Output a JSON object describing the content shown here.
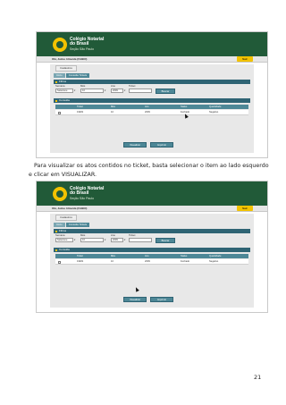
{
  "screenshots": [
    {
      "logo": {
        "line1": "Colégio Notarial",
        "line2": "do Brasil",
        "line3": "Seção São Paulo"
      },
      "user_text": "Olá, Jaime Almeida (FABIO)",
      "logout_label": "Sair",
      "menu_tab": "Cadastros",
      "breadcrumbs": [
        "Início",
        "Consulta Tickets"
      ],
      "filter_panel_title": "Filtros",
      "filters": {
        "semana_label": "Semana",
        "semana_value": "Selecione",
        "mes_label": "Mês",
        "mes_value": "10",
        "ano_label": "Ano",
        "ano_value": "2009",
        "ticket_label": "Ticket",
        "ticket_value": ""
      },
      "search_button": "Buscar",
      "result_panel_title": "Consulta",
      "columns": [
        "Ticket",
        "Mês",
        "Ano",
        "Status",
        "Quantidade"
      ],
      "rows": [
        {
          "ticket": "19481",
          "mes": "10",
          "ano": "2009",
          "status": "Fechado",
          "quantidade": "Negativo"
        }
      ],
      "action_buttons": [
        "Visualizar",
        "Imprimir"
      ]
    },
    {
      "logo": {
        "line1": "Colégio Notarial",
        "line2": "do Brasil",
        "line3": "Seção São Paulo"
      },
      "user_text": "Olá, Jaime Almeida (FABIO)",
      "logout_label": "Sair",
      "menu_tab": "Cadastros",
      "breadcrumbs": [
        "Início",
        "Consulta Tickets"
      ],
      "filter_panel_title": "Filtros",
      "filters": {
        "semana_label": "Semana",
        "semana_value": "Selecione",
        "mes_label": "Mês",
        "mes_value": "10",
        "ano_label": "Ano",
        "ano_value": "2009",
        "ticket_label": "Ticket",
        "ticket_value": ""
      },
      "search_button": "Buscar",
      "result_panel_title": "Consulta",
      "columns": [
        "Ticket",
        "Mês",
        "Ano",
        "Status",
        "Quantidade"
      ],
      "rows": [
        {
          "ticket": "19481",
          "mes": "10",
          "ano": "2009",
          "status": "Fechado",
          "quantidade": "Negativo"
        }
      ],
      "action_buttons": [
        "Visualizar",
        "Imprimir"
      ]
    }
  ],
  "caption": "Para visualizar os atos contidos no ticket, basta selecionar o item ao lado esquerdo e clicar em VISUALIZAR.",
  "page_number": "21",
  "colors": {
    "header_green": "#215a38",
    "logo_gold": "#f2c200",
    "panel_teal": "#2f6474",
    "button_teal": "#4d8796"
  }
}
